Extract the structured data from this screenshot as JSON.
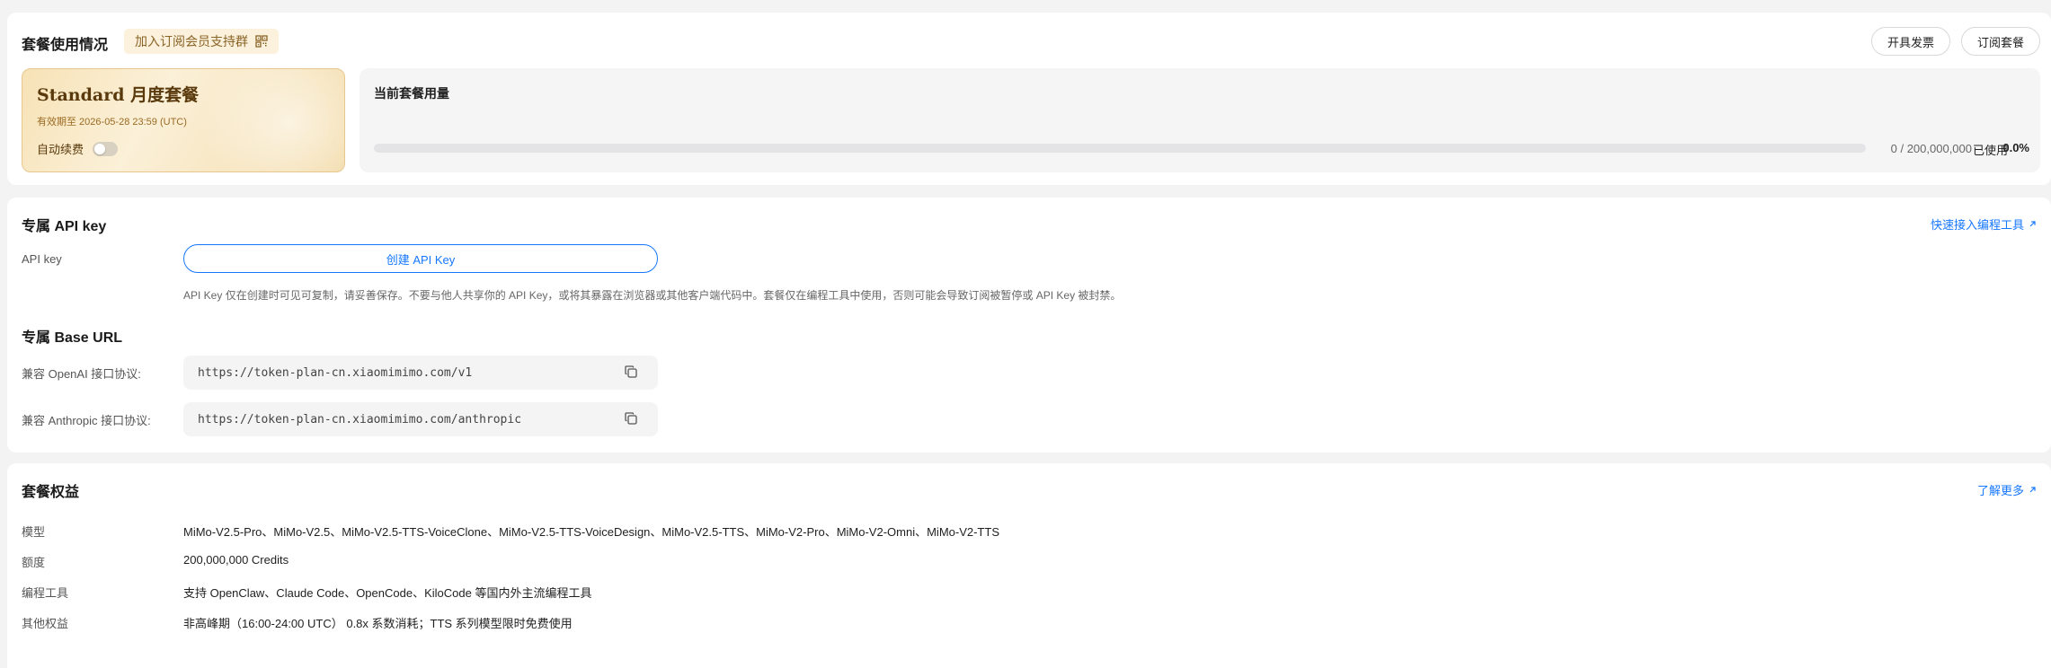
{
  "plan_usage": {
    "title": "套餐使用情况",
    "join_group_label": "加入订阅会员支持群",
    "invoice_button": "开具发票",
    "subscribe_button": "订阅套餐",
    "plan_name": "Standard 月度套餐",
    "valid_until": "有效期至 2026-05-28 23:59 (UTC)",
    "auto_renew_label": "自动续费",
    "auto_renew_on": false,
    "current_usage_title": "当前套餐用量",
    "usage_count": "0 / 200,000,000",
    "used_label": "已使用",
    "used_percent": "0.0%",
    "progress_fraction": 0.0
  },
  "api_key": {
    "title": "专属 API key",
    "quick_link": "快速接入编程工具",
    "field_label": "API key",
    "create_button": "创建 API Key",
    "note": "API Key 仅在创建时可见可复制，请妥善保存。不要与他人共享你的 API Key，或将其暴露在浏览器或其他客户端代码中。套餐仅在编程工具中使用，否则可能会导致订阅被暂停或 API Key 被封禁。"
  },
  "base_url": {
    "title": "专属 Base URL",
    "openai_label": "兼容 OpenAI 接口协议:",
    "openai_url": "https://token-plan-cn.xiaomimimo.com/v1",
    "anthropic_label": "兼容 Anthropic 接口协议:",
    "anthropic_url": "https://token-plan-cn.xiaomimimo.com/anthropic"
  },
  "rights": {
    "title": "套餐权益",
    "learn_more": "了解更多",
    "rows": [
      {
        "label": "模型",
        "value": "MiMo-V2.5-Pro、MiMo-V2.5、MiMo-V2.5-TTS-VoiceClone、MiMo-V2.5-TTS-VoiceDesign、MiMo-V2.5-TTS、MiMo-V2-Pro、MiMo-V2-Omni、MiMo-V2-TTS"
      },
      {
        "label": "额度",
        "value": "200,000,000 Credits"
      },
      {
        "label": "编程工具",
        "value": "支持 OpenClaw、Claude Code、OpenCode、KiloCode 等国内外主流编程工具"
      },
      {
        "label": "其他权益",
        "value": "非高峰期（16:00-24:00 UTC） 0.8x 系数消耗；TTS 系列模型限时免费使用"
      }
    ]
  },
  "colors": {
    "accent": "#1677ff",
    "plan_gold": "#f7e2b6",
    "plan_text": "#5a3a0d"
  },
  "icons": [
    "qr-code-icon",
    "arrow-up-right-icon",
    "copy-icon"
  ]
}
